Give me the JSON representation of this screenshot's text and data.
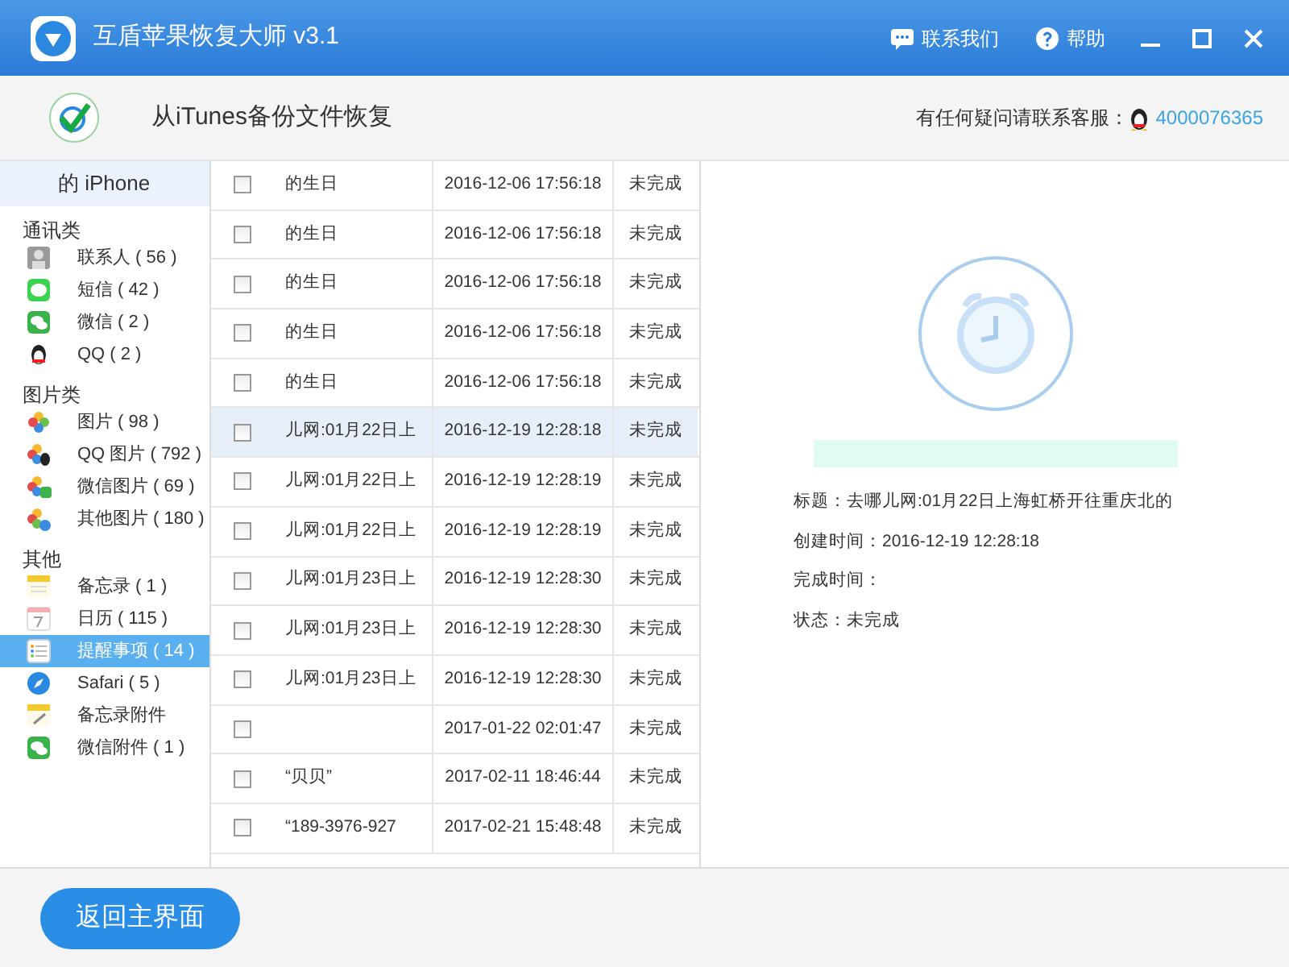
{
  "window": {
    "title": "互盾苹果恢复大师 v3.1",
    "actions": [
      "联系我们",
      "帮助"
    ]
  },
  "header": {
    "title": "从iTunes备份文件恢复",
    "support_label": "有任何疑问请联系客服：",
    "support_number": "4000076365"
  },
  "sidebar": {
    "device": "的 iPhone",
    "groups": [
      {
        "label": "通讯类",
        "items": [
          {
            "kind": "contacts",
            "label": "联系人 ( 56 )",
            "selected": false
          },
          {
            "kind": "messages",
            "label": "短信 ( 42 )",
            "selected": false
          },
          {
            "kind": "wechat",
            "label": "微信 ( 2 )",
            "selected": false
          },
          {
            "kind": "qq",
            "label": "QQ ( 2 )",
            "selected": false
          }
        ]
      },
      {
        "label": "图片类",
        "items": [
          {
            "kind": "photos",
            "label": "图片 ( 98 )",
            "selected": false
          },
          {
            "kind": "qqphotos",
            "label": "QQ 图片 ( 792 )",
            "selected": false
          },
          {
            "kind": "wechatphotos",
            "label": "微信图片 ( 69 )",
            "selected": false
          },
          {
            "kind": "otherphotos",
            "label": "其他图片 ( 180 )",
            "selected": false
          }
        ]
      },
      {
        "label": "其他",
        "items": [
          {
            "kind": "notes",
            "label": "备忘录 ( 1 )",
            "selected": false
          },
          {
            "kind": "calendar",
            "label": "日历 ( 115 )",
            "selected": false
          },
          {
            "kind": "reminders",
            "label": "提醒事项 ( 14 )",
            "selected": true
          },
          {
            "kind": "safari",
            "label": "Safari ( 5 )",
            "selected": false
          },
          {
            "kind": "noteattach",
            "label": "备忘录附件",
            "selected": false
          },
          {
            "kind": "wechatattach",
            "label": "微信附件 ( 1 )",
            "selected": false
          }
        ]
      }
    ]
  },
  "table": {
    "rows": [
      {
        "checked": false,
        "selected": false,
        "title": "的生日",
        "time": "2016-12-06 17:56:18",
        "status": "未完成"
      },
      {
        "checked": false,
        "selected": false,
        "title": "的生日",
        "time": "2016-12-06 17:56:18",
        "status": "未完成"
      },
      {
        "checked": false,
        "selected": false,
        "title": "的生日",
        "time": "2016-12-06 17:56:18",
        "status": "未完成"
      },
      {
        "checked": false,
        "selected": false,
        "title": "的生日",
        "time": "2016-12-06 17:56:18",
        "status": "未完成"
      },
      {
        "checked": false,
        "selected": false,
        "title": "的生日",
        "time": "2016-12-06 17:56:18",
        "status": "未完成"
      },
      {
        "checked": false,
        "selected": true,
        "title": "儿网:01月22日上",
        "time": "2016-12-19 12:28:18",
        "status": "未完成"
      },
      {
        "checked": false,
        "selected": false,
        "title": "儿网:01月22日上",
        "time": "2016-12-19 12:28:19",
        "status": "未完成"
      },
      {
        "checked": false,
        "selected": false,
        "title": "儿网:01月22日上",
        "time": "2016-12-19 12:28:19",
        "status": "未完成"
      },
      {
        "checked": false,
        "selected": false,
        "title": "儿网:01月23日上",
        "time": "2016-12-19 12:28:30",
        "status": "未完成"
      },
      {
        "checked": false,
        "selected": false,
        "title": "儿网:01月23日上",
        "time": "2016-12-19 12:28:30",
        "status": "未完成"
      },
      {
        "checked": false,
        "selected": false,
        "title": "儿网:01月23日上",
        "time": "2016-12-19 12:28:30",
        "status": "未完成"
      },
      {
        "checked": false,
        "selected": false,
        "time": "2017-01-22 02:01:47",
        "status": "未完成"
      },
      {
        "checked": false,
        "selected": false,
        "title": "“贝贝”",
        "time": "2017-02-11 18:46:44",
        "status": "未完成"
      },
      {
        "checked": false,
        "selected": false,
        "title": "“189-3976-927",
        "time": "2017-02-21 15:48:48",
        "status": "未完成"
      }
    ]
  },
  "detail": {
    "lines": [
      "标题：去哪儿网:01月22日上海虹桥开往重庆北的",
      "创建时间：2016-12-19 12:28:18",
      "完成时间：",
      "状态：未完成"
    ]
  },
  "footer": {
    "button": "返回主界面"
  }
}
